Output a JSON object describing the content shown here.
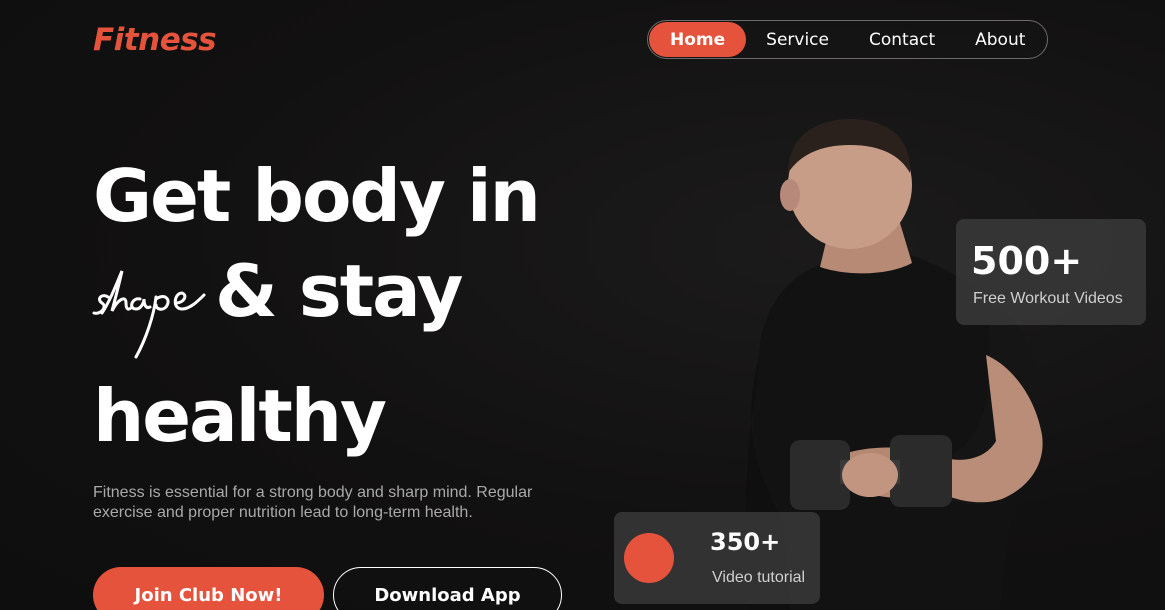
{
  "brand": {
    "logo": "Fitness",
    "accent_color": "#e5533c"
  },
  "nav": {
    "items": [
      {
        "label": "Home",
        "active": true
      },
      {
        "label": "Service",
        "active": false
      },
      {
        "label": "Contact",
        "active": false
      },
      {
        "label": "About",
        "active": false
      }
    ]
  },
  "hero": {
    "line1": "Get body in",
    "script_word": "shape",
    "line2": "& stay",
    "line3": "healthy",
    "description": "Fitness is essential for a strong body and sharp mind. Regular exercise and proper nutrition lead to long-term health.",
    "primary_button": "Join Club Now!",
    "secondary_button": "Download App"
  },
  "stats": {
    "workouts": {
      "value": "500+",
      "label": "Free Workout Videos"
    },
    "tutorials": {
      "value": "350+",
      "label": "Video tutorial"
    }
  }
}
